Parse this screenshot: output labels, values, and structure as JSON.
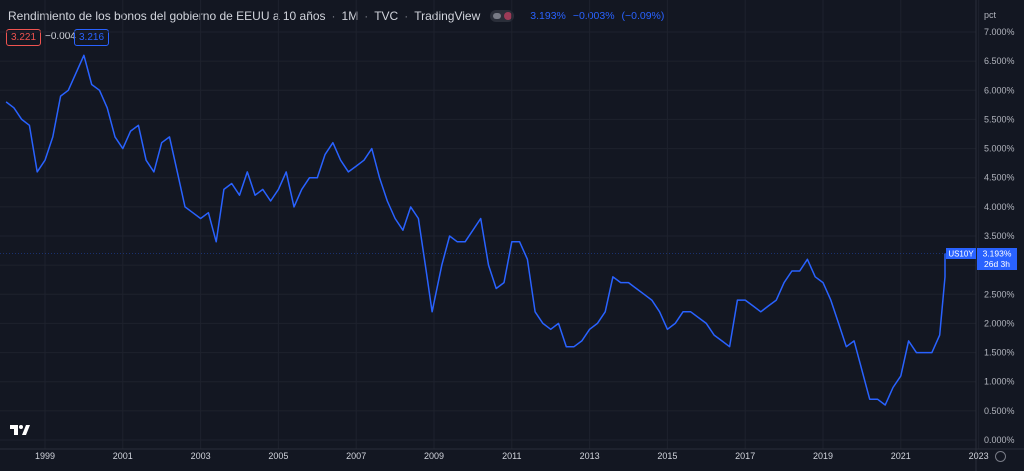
{
  "header": {
    "title": "Rendimiento de los bonos del gobierno de EEUU a 10 años",
    "interval": "1M",
    "source": "TVC",
    "provider": "TradingView",
    "last": "3.193%",
    "change": "−0.003%",
    "change_pct": "(−0.09%)"
  },
  "orders": {
    "sell": "3.221",
    "spread": "−0.004",
    "buy": "3.216"
  },
  "price_label": {
    "symbol": "US10Y",
    "value": "3.193%",
    "countdown": "26d 3h"
  },
  "colors": {
    "background": "#131722",
    "line": "#2962ff",
    "sell": "#ef5350",
    "grid": "#1e222d"
  },
  "icons": {
    "logo": "tradingview-logo-icon",
    "settings": "gear-icon",
    "visibility": "eye-toggle-icon"
  },
  "chart_data": {
    "type": "line",
    "unit_label": "pct",
    "ylim": [
      0,
      7
    ],
    "y_ticks": [
      "0.000%",
      "0.500%",
      "1.000%",
      "1.500%",
      "2.000%",
      "2.500%",
      "3.000%",
      "3.500%",
      "4.000%",
      "4.500%",
      "5.000%",
      "5.500%",
      "6.000%",
      "6.500%",
      "7.000%"
    ],
    "x_ticks": [
      "1999",
      "2001",
      "2003",
      "2005",
      "2007",
      "2009",
      "2011",
      "2013",
      "2015",
      "2017",
      "2019",
      "2021",
      "2023"
    ],
    "series": [
      {
        "x": [
          1998.0,
          1998.2,
          1998.4,
          1998.6,
          1998.8,
          1999.0,
          1999.2,
          1999.4,
          1999.6,
          1999.8,
          2000.0,
          2000.2,
          2000.4,
          2000.6,
          2000.8,
          2001.0,
          2001.2,
          2001.4,
          2001.6,
          2001.8,
          2002.0,
          2002.2,
          2002.4,
          2002.6,
          2002.8,
          2003.0,
          2003.2,
          2003.4,
          2003.6,
          2003.8,
          2004.0,
          2004.2,
          2004.4,
          2004.6,
          2004.8,
          2005.0,
          2005.2,
          2005.4,
          2005.6,
          2005.8,
          2006.0,
          2006.2,
          2006.4,
          2006.6,
          2006.8,
          2007.0,
          2007.2,
          2007.4,
          2007.6,
          2007.8,
          2008.0,
          2008.2,
          2008.4,
          2008.6,
          2008.8,
          2008.95,
          2009.2,
          2009.4,
          2009.6,
          2009.8,
          2010.0,
          2010.2,
          2010.4,
          2010.6,
          2010.8,
          2011.0,
          2011.2,
          2011.4,
          2011.6,
          2011.8,
          2012.0,
          2012.2,
          2012.4,
          2012.6,
          2012.8,
          2013.0,
          2013.2,
          2013.4,
          2013.6,
          2013.8,
          2014.0,
          2014.2,
          2014.4,
          2014.6,
          2014.8,
          2015.0,
          2015.2,
          2015.4,
          2015.6,
          2015.8,
          2016.0,
          2016.2,
          2016.4,
          2016.6,
          2016.8,
          2017.0,
          2017.2,
          2017.4,
          2017.6,
          2017.8,
          2018.0,
          2018.2,
          2018.4,
          2018.6,
          2018.8,
          2019.0,
          2019.2,
          2019.4,
          2019.6,
          2019.8,
          2020.0,
          2020.2,
          2020.4,
          2020.6,
          2020.8,
          2021.0,
          2021.2,
          2021.4,
          2021.6,
          2021.8,
          2022.0,
          2022.2,
          2022.4,
          2022.6,
          2022.8,
          2023.0
        ],
        "values": [
          5.8,
          5.7,
          5.5,
          5.4,
          4.6,
          4.8,
          5.2,
          5.9,
          6.0,
          6.3,
          6.6,
          6.1,
          6.0,
          5.7,
          5.2,
          5.0,
          5.3,
          5.4,
          4.8,
          4.6,
          5.1,
          5.2,
          4.6,
          4.0,
          3.9,
          3.8,
          3.9,
          3.4,
          4.3,
          4.4,
          4.2,
          4.6,
          4.2,
          4.3,
          4.1,
          4.3,
          4.6,
          4.0,
          4.3,
          4.5,
          4.5,
          4.9,
          5.1,
          4.8,
          4.6,
          4.7,
          4.8,
          5.0,
          4.5,
          4.1,
          3.8,
          3.6,
          4.0,
          3.8,
          2.9,
          2.2,
          3.0,
          3.5,
          3.4,
          3.4,
          3.6,
          3.8,
          3.0,
          2.6,
          2.7,
          3.4,
          3.4,
          3.1,
          2.2,
          2.0,
          1.9,
          2.0,
          1.6,
          1.6,
          1.7,
          1.9,
          2.0,
          2.2,
          2.8,
          2.7,
          2.7,
          2.6,
          2.5,
          2.4,
          2.2,
          1.9,
          2.0,
          2.2,
          2.2,
          2.1,
          2.0,
          1.8,
          1.7,
          1.6,
          2.4,
          2.4,
          2.3,
          2.2,
          2.3,
          2.4,
          2.7,
          2.9,
          2.9,
          3.1,
          2.8,
          2.7,
          2.4,
          2.0,
          1.6,
          1.7,
          1.2,
          0.7,
          0.7,
          0.6,
          0.9,
          1.1,
          1.7,
          1.5,
          1.5,
          1.5,
          1.8,
          2.8,
          2.9,
          3.0,
          3.2,
          3.2
        ],
        "color": "#2962ff"
      }
    ],
    "grid": true
  }
}
